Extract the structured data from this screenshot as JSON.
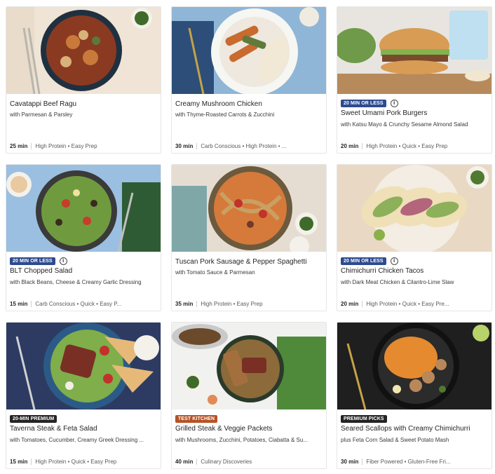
{
  "colors": {
    "badge_blue": "#2e4b8f",
    "badge_dark": "#242424",
    "badge_orange": "#b55226",
    "card_border": "#e6e6e6"
  },
  "cards": [
    {
      "title": "Cavatappi Beef Ragu",
      "subtitle": "with Parmesan & Parsley",
      "time": "25 min",
      "tags": "High Protein • Easy Prep",
      "badge": null
    },
    {
      "title": "Creamy Mushroom Chicken",
      "subtitle": "with Thyme-Roasted Carrots & Zucchini",
      "time": "30 min",
      "tags": "Carb Conscious • High Protein • ...",
      "badge": null
    },
    {
      "title": "Sweet Umami Pork Burgers",
      "subtitle": "with Katsu Mayo & Crunchy Sesame Almond Salad",
      "time": "20 min",
      "tags": "High Protein • Quick • Easy Prep",
      "badge": "20 MIN OR LESS",
      "badge_color": "#2e4b8f",
      "info_icon": true
    },
    {
      "title": "BLT Chopped Salad",
      "subtitle": "with Black Beans, Cheese & Creamy Garlic Dressing",
      "time": "15 min",
      "tags": "Carb Conscious • Quick • Easy P...",
      "badge": "20 MIN OR LESS",
      "badge_color": "#2e4b8f",
      "info_icon": true
    },
    {
      "title": "Tuscan Pork Sausage & Pepper Spaghetti",
      "subtitle": "with Tomato Sauce & Parmesan",
      "time": "35 min",
      "tags": "High Protein • Easy Prep",
      "badge": null
    },
    {
      "title": "Chimichurri Chicken Tacos",
      "subtitle": "with Dark Meat Chicken & Cilantro-Lime Slaw",
      "time": "20 min",
      "tags": "High Protein • Quick • Easy Pre...",
      "badge": "20 MIN OR LESS",
      "badge_color": "#2e4b8f",
      "info_icon": true
    },
    {
      "title": "Taverna Steak & Feta Salad",
      "subtitle": "with Tomatoes, Cucumber, Creamy Greek Dressing ...",
      "time": "15 min",
      "tags": "High Protein • Quick • Easy Prep",
      "badge": "20-MIN PREMIUM",
      "badge_color": "#242424",
      "info_icon": false
    },
    {
      "title": "Grilled Steak & Veggie Packets",
      "subtitle": "with Mushrooms, Zucchini, Potatoes, Ciabatta & Su...",
      "time": "40 min",
      "tags": "Culinary Discoveries",
      "badge": "TEST KITCHEN",
      "badge_color": "#b55226",
      "info_icon": false
    },
    {
      "title": "Seared Scallops with Creamy Chimichurri",
      "subtitle": "plus Feta Corn Salad & Sweet Potato Mash",
      "time": "30 min",
      "tags": "Fiber Powered • Gluten-Free Fri...",
      "badge": "PREMIUM PICKS",
      "badge_color": "#242424",
      "info_icon": false
    }
  ]
}
